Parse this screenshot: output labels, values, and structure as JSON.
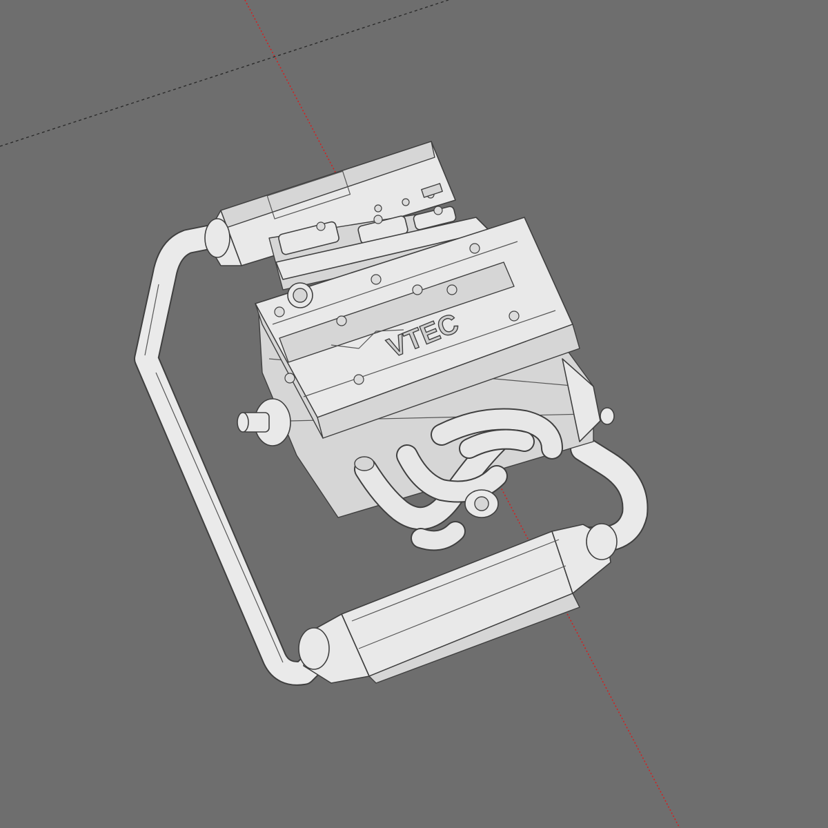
{
  "viewport": {
    "background_color": "#6e6e6e",
    "model_color": "#e9e9e9",
    "outline_color": "#3f3f3f"
  },
  "axes": {
    "red_axis_color": "#d42020",
    "black_axis_color": "#2a2a2a"
  },
  "model": {
    "valve_cover_logo": "VTEC"
  }
}
